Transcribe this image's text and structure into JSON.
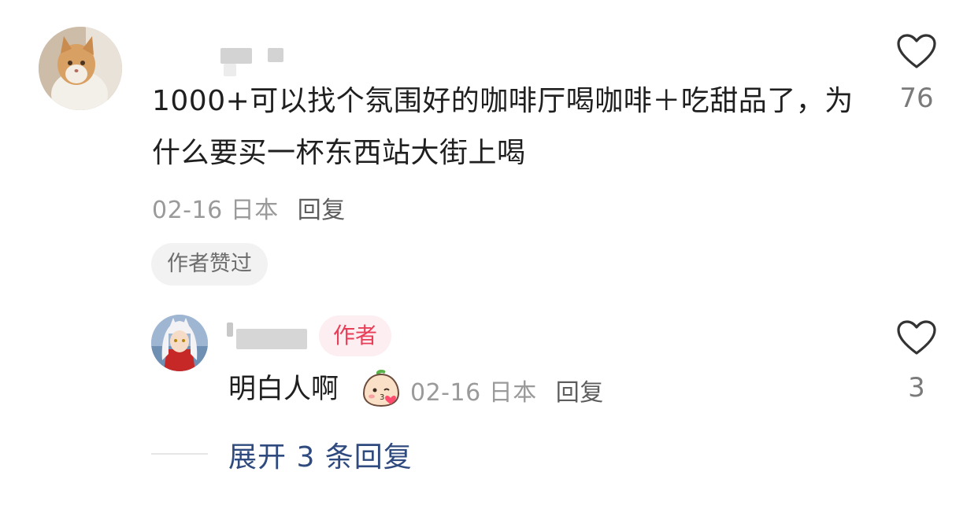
{
  "comment": {
    "avatar_icon": "cat-avatar",
    "text": "1000+可以找个氛围好的咖啡厅喝咖啡＋吃甜品了，为什么要买一杯东西站大街上喝",
    "date": "02-16",
    "location": "日本",
    "reply_label": "回复",
    "liked_badge": "作者赞过",
    "like_count": "76"
  },
  "reply": {
    "avatar_icon": "anime-avatar",
    "author_badge": "作者",
    "text": "明白人啊",
    "emoji_icon": "kiss-emoji-icon",
    "date": "02-16",
    "location": "日本",
    "reply_label": "回复",
    "like_count": "3"
  },
  "expand_label": "展开 3 条回复",
  "colors": {
    "author_badge_bg": "#fdeef1",
    "author_badge_text": "#e83e58",
    "expand_link": "#2f4a7e",
    "meta_gray": "#9a9a9a"
  }
}
